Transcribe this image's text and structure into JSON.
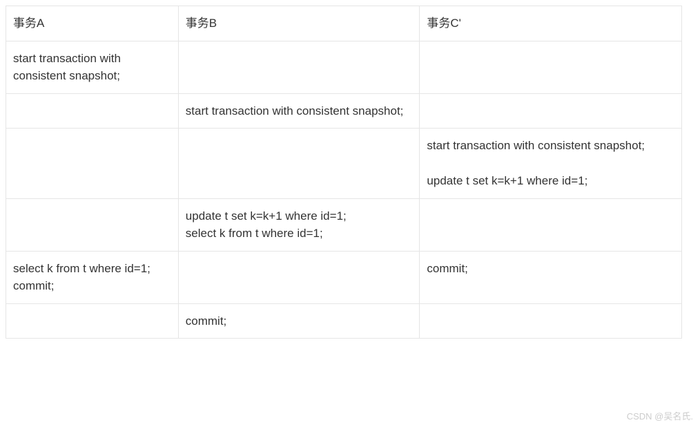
{
  "table": {
    "headers": {
      "colA": "事务A",
      "colB": "事务B",
      "colC": "事务C'"
    },
    "rows": [
      {
        "a": "start transaction with consistent snapshot;",
        "b": "",
        "c": ""
      },
      {
        "a": "",
        "b": "start transaction with consistent snapshot;",
        "c": ""
      },
      {
        "a": "",
        "b": "",
        "c": "start transaction with consistent snapshot;\n\nupdate t set k=k+1 where id=1;"
      },
      {
        "a": "",
        "b": "update t set k=k+1 where id=1;\nselect k from t where id=1;",
        "c": ""
      },
      {
        "a": "select k from t where id=1;\ncommit;",
        "b": "",
        "c": "commit;"
      },
      {
        "a": "",
        "b": "commit;",
        "c": ""
      }
    ]
  },
  "watermark": "CSDN @吴名氏."
}
